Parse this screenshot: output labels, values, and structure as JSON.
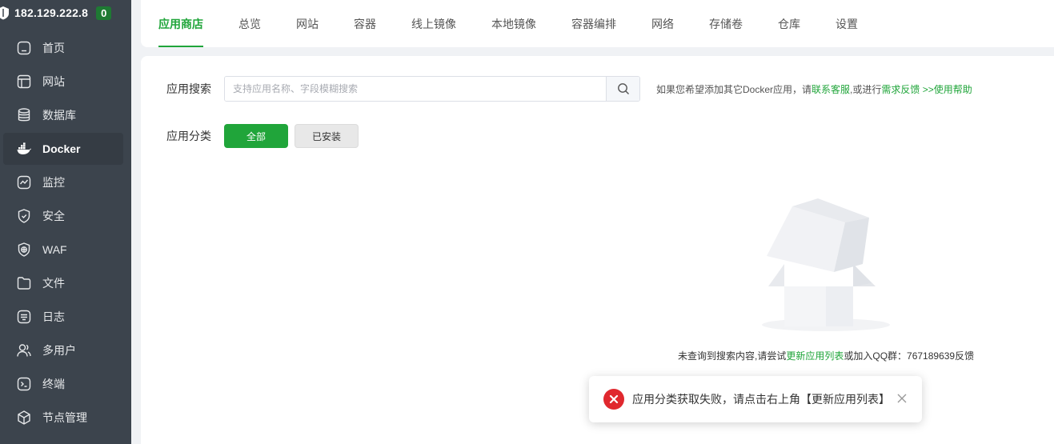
{
  "sidebar": {
    "server_ip": "182.129.222.8",
    "badge_count": "0",
    "items": [
      {
        "label": "首页",
        "icon": "home-icon"
      },
      {
        "label": "网站",
        "icon": "website-icon"
      },
      {
        "label": "数据库",
        "icon": "database-icon"
      },
      {
        "label": "Docker",
        "icon": "docker-icon"
      },
      {
        "label": "监控",
        "icon": "monitor-icon"
      },
      {
        "label": "安全",
        "icon": "shield-icon"
      },
      {
        "label": "WAF",
        "icon": "waf-icon"
      },
      {
        "label": "文件",
        "icon": "folder-icon"
      },
      {
        "label": "日志",
        "icon": "log-icon"
      },
      {
        "label": "多用户",
        "icon": "users-icon"
      },
      {
        "label": "终端",
        "icon": "terminal-icon"
      },
      {
        "label": "节点管理",
        "icon": "node-icon"
      }
    ],
    "active_item": "Docker"
  },
  "topnav": {
    "tabs": [
      "应用商店",
      "总览",
      "网站",
      "容器",
      "线上镜像",
      "本地镜像",
      "容器编排",
      "网络",
      "存储卷",
      "仓库",
      "设置"
    ],
    "active_tab": "应用商店"
  },
  "search": {
    "label": "应用搜索",
    "placeholder": "支持应用名称、字段模糊搜索",
    "value": "",
    "hint_prefix": "如果您希望添加其它Docker应用，请",
    "hint_link1": "联系客服",
    "hint_mid": ",或进行",
    "hint_link2": "需求反馈",
    "hint_link3": ">>使用帮助"
  },
  "category": {
    "label": "应用分类",
    "buttons": [
      "全部",
      "已安装"
    ],
    "active": "全部"
  },
  "empty": {
    "text_prefix": "未查询到搜索内容,请尝试",
    "link": "更新应用列表",
    "text_suffix": "或加入QQ群：767189639反馈"
  },
  "toast": {
    "type": "error",
    "message": "应用分类获取失败，请点击右上角【更新应用列表】"
  },
  "colors": {
    "accent": "#20a53a",
    "sidebar_bg": "#3c444d",
    "error": "#e0282e"
  }
}
